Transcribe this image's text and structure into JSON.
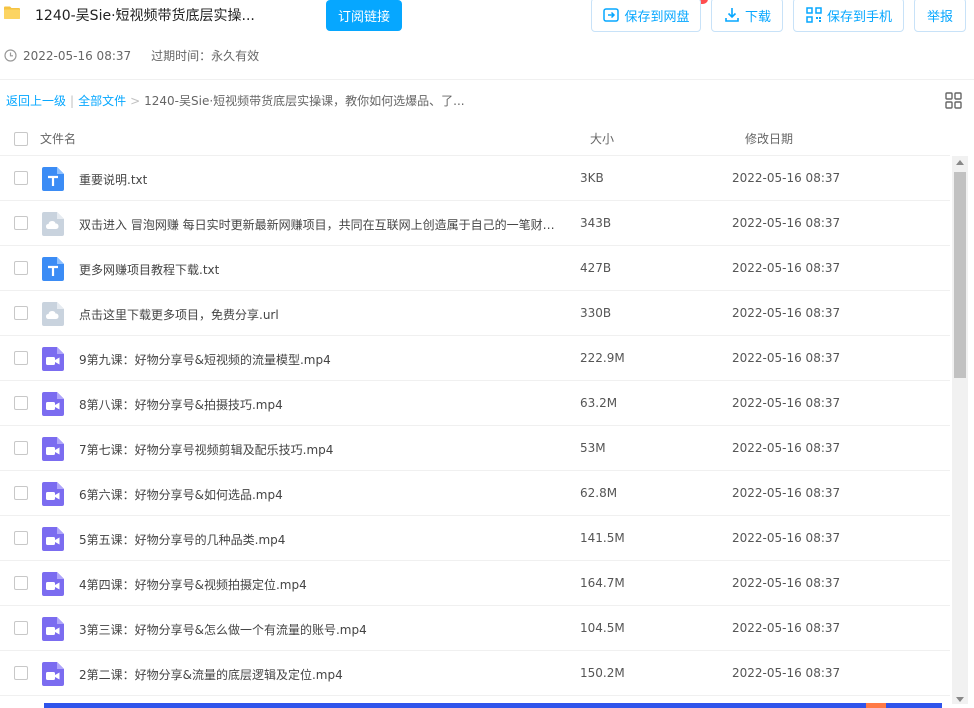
{
  "header": {
    "title": "1240-吴Sie·短视频带货底层实操...",
    "subscribe_label": "订阅链接",
    "save_label": "保存到网盘",
    "download_label": "下载",
    "phone_label": "保存到手机",
    "report_label": "举报",
    "share_date": "2022-05-16 08:37",
    "expire_text": "过期时间：永久有效"
  },
  "breadcrumb": {
    "back": "返回上一级",
    "all": "全部文件",
    "current": "1240-吴Sie·短视频带货底层实操课，教你如何选爆品、了..."
  },
  "table": {
    "col_name": "文件名",
    "col_size": "大小",
    "col_date": "修改日期",
    "rows": [
      {
        "name": "重要说明.txt",
        "size": "3KB",
        "date": "2022-05-16 08:37",
        "icon": "txt-file-icon"
      },
      {
        "name": "双击进入 冒泡网赚 每日实时更新最新网赚项目，共同在互联网上创造属于自己的一笔财富.url",
        "size": "343B",
        "date": "2022-05-16 08:37",
        "icon": "url-file-icon"
      },
      {
        "name": "更多网赚项目教程下载.txt",
        "size": "427B",
        "date": "2022-05-16 08:37",
        "icon": "txt-file-icon"
      },
      {
        "name": "点击这里下载更多项目，免费分享.url",
        "size": "330B",
        "date": "2022-05-16 08:37",
        "icon": "url-file-icon"
      },
      {
        "name": "9第九课：好物分享号&短视频的流量模型.mp4",
        "size": "222.9M",
        "date": "2022-05-16 08:37",
        "icon": "video-file-icon"
      },
      {
        "name": "8第八课：好物分享号&拍摄技巧.mp4",
        "size": "63.2M",
        "date": "2022-05-16 08:37",
        "icon": "video-file-icon"
      },
      {
        "name": "7第七课：好物分享号视频剪辑及配乐技巧.mp4",
        "size": "53M",
        "date": "2022-05-16 08:37",
        "icon": "video-file-icon"
      },
      {
        "name": "6第六课：好物分享号&如何选品.mp4",
        "size": "62.8M",
        "date": "2022-05-16 08:37",
        "icon": "video-file-icon"
      },
      {
        "name": "5第五课：好物分享号的几种品类.mp4",
        "size": "141.5M",
        "date": "2022-05-16 08:37",
        "icon": "video-file-icon"
      },
      {
        "name": "4第四课：好物分享号&视频拍摄定位.mp4",
        "size": "164.7M",
        "date": "2022-05-16 08:37",
        "icon": "video-file-icon"
      },
      {
        "name": "3第三课：好物分享号&怎么做一个有流量的账号.mp4",
        "size": "104.5M",
        "date": "2022-05-16 08:37",
        "icon": "video-file-icon"
      },
      {
        "name": "2第二课：好物分享&流量的底层逻辑及定位.mp4",
        "size": "150.2M",
        "date": "2022-05-16 08:37",
        "icon": "video-file-icon"
      }
    ]
  },
  "colors": {
    "accent": "#06a7ff",
    "txt_icon": "#3b8cf5",
    "url_icon": "#c9d3de",
    "video_icon": "#7b6cf0"
  }
}
